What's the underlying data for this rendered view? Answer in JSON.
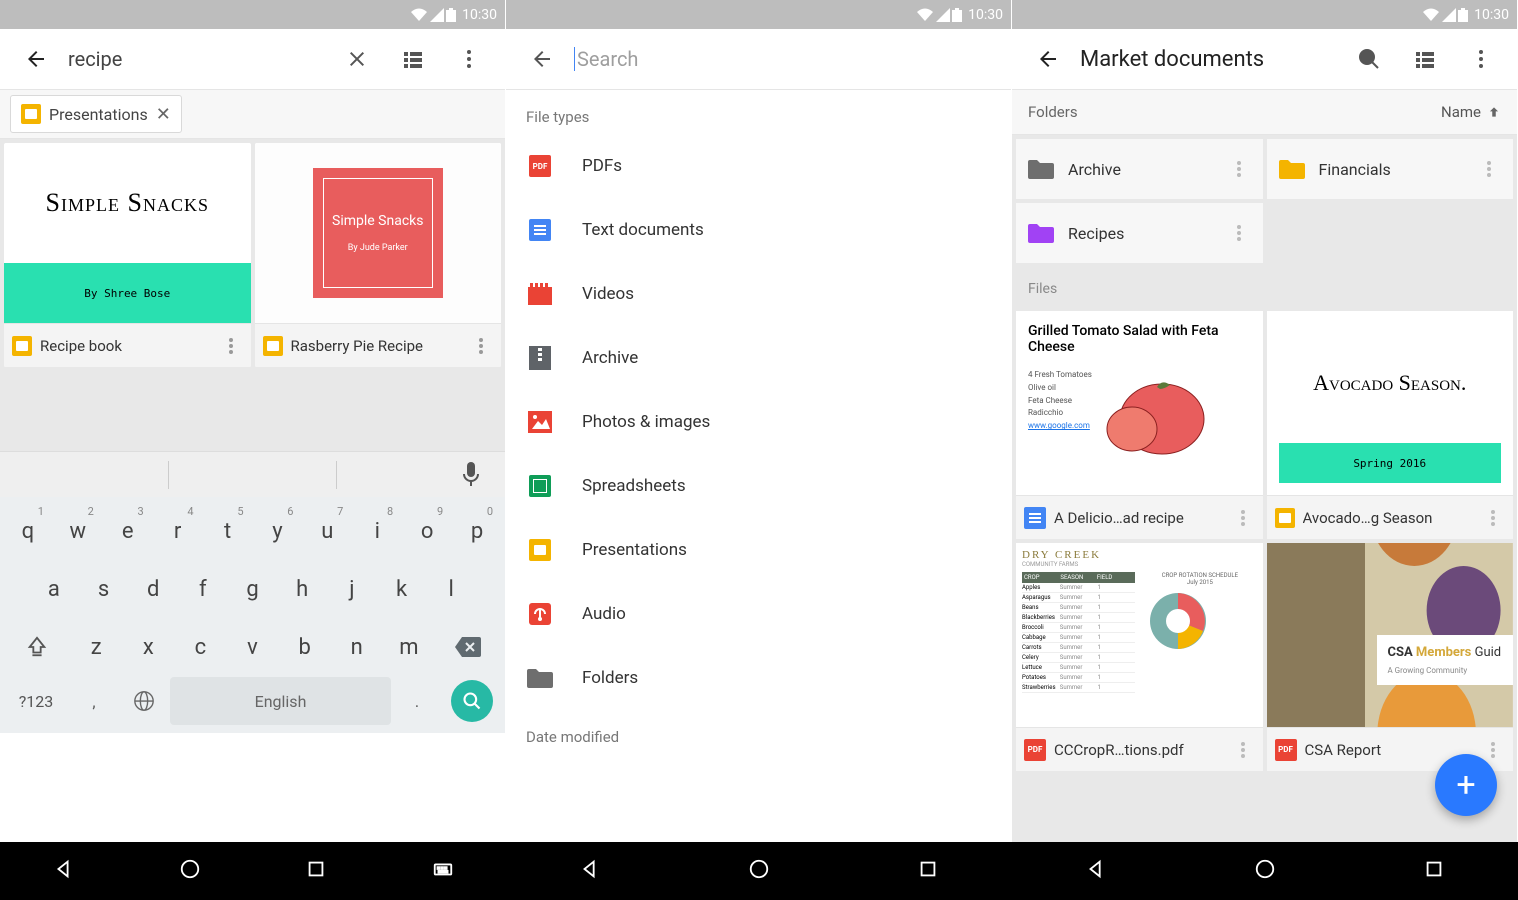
{
  "status_time": "10:30",
  "screen1": {
    "search_value": "recipe",
    "chip_label": "Presentations",
    "results": [
      {
        "title": "Recipe book",
        "thumb_title": "Simple Snacks",
        "thumb_author": "By Shree Bose"
      },
      {
        "title": "Rasberry Pie Recipe",
        "thumb_title": "Simple Snacks",
        "thumb_author": "By Jude Parker"
      }
    ],
    "keyboard": {
      "row1": [
        "q",
        "w",
        "e",
        "r",
        "t",
        "y",
        "u",
        "i",
        "o",
        "p"
      ],
      "nums": [
        "1",
        "2",
        "3",
        "4",
        "5",
        "6",
        "7",
        "8",
        "9",
        "0"
      ],
      "row2": [
        "a",
        "s",
        "d",
        "f",
        "g",
        "h",
        "j",
        "k",
        "l"
      ],
      "row3": [
        "z",
        "x",
        "c",
        "v",
        "b",
        "n",
        "m"
      ],
      "sym": "?123",
      "lang": "English"
    }
  },
  "screen2": {
    "search_placeholder": "Search",
    "section1": "File types",
    "types": [
      "PDFs",
      "Text documents",
      "Videos",
      "Archive",
      "Photos & images",
      "Spreadsheets",
      "Presentations",
      "Audio",
      "Folders"
    ],
    "section2": "Date modified"
  },
  "screen3": {
    "title": "Market documents",
    "section_folders": "Folders",
    "sort_label": "Name",
    "folders": [
      {
        "name": "Archive",
        "color": "#6E6E6E"
      },
      {
        "name": "Financials",
        "color": "#F4B400"
      },
      {
        "name": "Recipes",
        "color": "#A142F4"
      }
    ],
    "section_files": "Files",
    "files": [
      {
        "name": "A Delicio…ad recipe",
        "type": "doc",
        "title": "Grilled Tomato Salad with Feta Cheese",
        "subtitle": "4 Fresh Tomatoes\nOlive oil\nFeta Cheese\nRadicchio\nwww.google.com"
      },
      {
        "name": "Avocado…g Season",
        "type": "slides",
        "title": "Avocado Season.",
        "subtitle": "Spring 2016"
      },
      {
        "name": "CCCropR…tions.pdf",
        "type": "pdf",
        "title": "DRY CREEK",
        "subtitle": "CROP ROTATION SCHEDULE"
      },
      {
        "name": "CSA Report",
        "type": "pdf",
        "title": "CSA Members Guide",
        "subtitle": "A Growing Community"
      }
    ]
  }
}
